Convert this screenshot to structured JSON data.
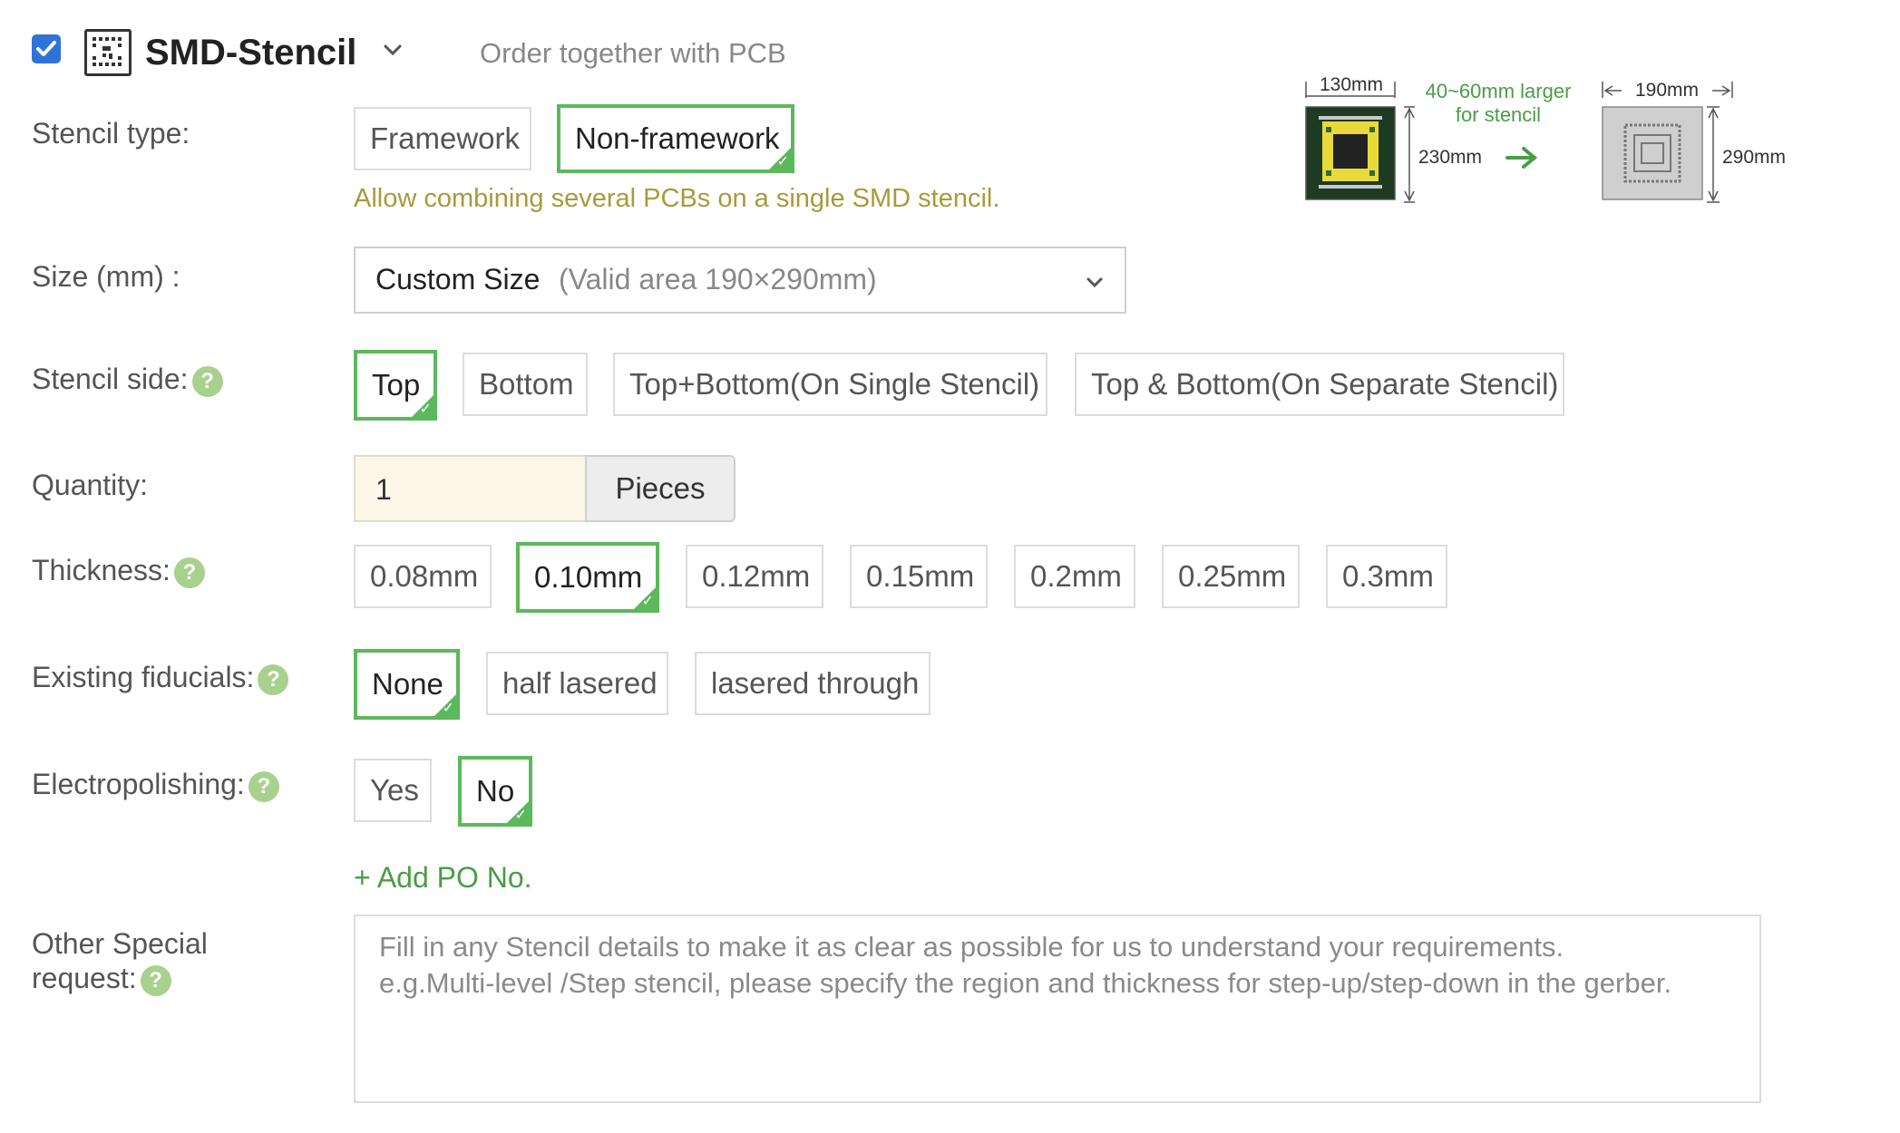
{
  "header": {
    "checkbox_checked": true,
    "title": "SMD-Stencil",
    "subtitle": "Order together with PCB"
  },
  "diagram": {
    "pcb_width": "130mm",
    "pcb_height": "230mm",
    "larger_note_line1": "40~60mm larger",
    "larger_note_line2": "for stencil",
    "stencil_width": "190mm",
    "stencil_height": "290mm"
  },
  "stencil_type": {
    "label": "Stencil type:",
    "options": [
      "Framework",
      "Non-framework"
    ],
    "selected": "Non-framework",
    "hint": "Allow combining several PCBs on a single SMD stencil."
  },
  "size": {
    "label": "Size (mm) :",
    "value": "Custom Size",
    "note": "(Valid area 190×290mm)"
  },
  "stencil_side": {
    "label": "Stencil side:",
    "options": [
      "Top",
      "Bottom",
      "Top+Bottom(On Single Stencil)",
      "Top & Bottom(On Separate Stencil)"
    ],
    "selected": "Top"
  },
  "quantity": {
    "label": "Quantity:",
    "value": "1",
    "unit": "Pieces"
  },
  "thickness": {
    "label": "Thickness:",
    "options": [
      "0.08mm",
      "0.10mm",
      "0.12mm",
      "0.15mm",
      "0.2mm",
      "0.25mm",
      "0.3mm"
    ],
    "selected": "0.10mm"
  },
  "fiducials": {
    "label": "Existing fiducials:",
    "options": [
      "None",
      "half lasered",
      "lasered through"
    ],
    "selected": "None"
  },
  "electropolishing": {
    "label": "Electropolishing:",
    "options": [
      "Yes",
      "No"
    ],
    "selected": "No"
  },
  "add_po": "+ Add PO No.",
  "special_request": {
    "label_line1": "Other Special",
    "label_line2": "request:",
    "placeholder": "Fill in any Stencil details to make it as clear as possible for us to understand your requirements.\ne.g.Multi-level /Step stencil, please specify the region and thickness for step-up/step-down in the gerber."
  },
  "help_icon": "?",
  "colors": {
    "accent_green": "#5cb85c",
    "hint_olive": "#a89a3a",
    "checkbox_blue": "#2f73d9",
    "quantity_bg": "#fcf7e8"
  }
}
